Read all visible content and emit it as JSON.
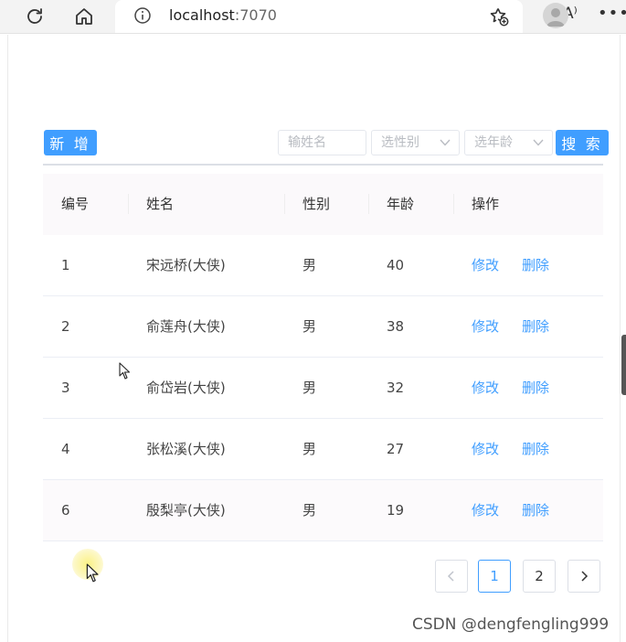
{
  "browser": {
    "address_host": "localhost",
    "address_port": ":7070",
    "read_aloud_label": "A⁾"
  },
  "controls": {
    "add_label": "新 增",
    "name_placeholder": "输姓名",
    "gender_placeholder": "选性别",
    "age_placeholder": "选年龄",
    "search_label": "搜 索"
  },
  "table": {
    "headers": [
      "编号",
      "姓名",
      "性别",
      "年龄",
      "操作"
    ],
    "rows": [
      {
        "id": "1",
        "name": "宋远桥(大侠)",
        "gender": "男",
        "age": "40",
        "edit": "修改",
        "delete": "删除"
      },
      {
        "id": "2",
        "name": "俞莲舟(大侠)",
        "gender": "男",
        "age": "38",
        "edit": "修改",
        "delete": "删除"
      },
      {
        "id": "3",
        "name": "俞岱岩(大侠)",
        "gender": "男",
        "age": "32",
        "edit": "修改",
        "delete": "删除"
      },
      {
        "id": "4",
        "name": "张松溪(大侠)",
        "gender": "男",
        "age": "27",
        "edit": "修改",
        "delete": "删除"
      },
      {
        "id": "6",
        "name": "殷梨亭(大侠)",
        "gender": "男",
        "age": "19",
        "edit": "修改",
        "delete": "删除"
      }
    ]
  },
  "pagination": {
    "prev": "<",
    "pages": [
      "1",
      "2"
    ],
    "current": "1",
    "next": ">"
  },
  "watermark": "CSDN @dengfengling999",
  "colors": {
    "primary": "#409eff",
    "border": "#dcdfe6",
    "header_bg": "#fbf9fb"
  },
  "icons": [
    "reload-icon",
    "home-icon",
    "info-icon",
    "read-aloud-icon",
    "favorites-icon",
    "profile-icon",
    "more-icon",
    "chevron-down-icon",
    "chevron-left-icon",
    "chevron-right-icon",
    "cursor-icon"
  ]
}
